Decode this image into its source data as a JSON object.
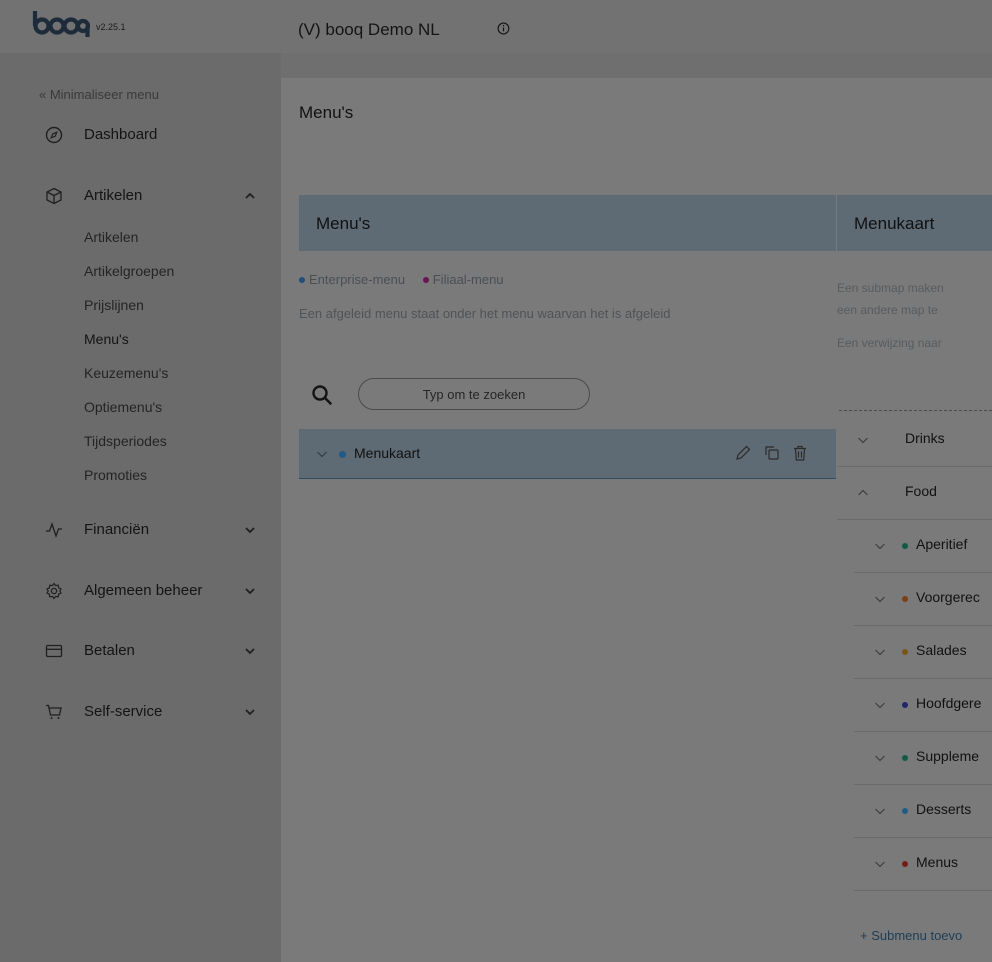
{
  "header": {
    "version": "v2.25.1",
    "venue": "(V) booq Demo NL",
    "brand_color": "#1d2b3b"
  },
  "sidebar": {
    "minimize_label": "« Minimaliseer menu",
    "dashboard": "Dashboard",
    "artikelen": {
      "label": "Artikelen",
      "items": [
        "Artikelen",
        "Artikelgroepen",
        "Prijslijnen",
        "Menu's",
        "Keuzemenu's",
        "Optiemenu's",
        "Tijdsperiodes",
        "Promoties"
      ]
    },
    "financien": "Financiën",
    "algemeen": "Algemeen beheer",
    "betalen": "Betalen",
    "selfservice": "Self-service"
  },
  "page": {
    "title": "Menu's"
  },
  "left_panel": {
    "header": "Menu's",
    "legend_enterprise": "Enterprise-menu",
    "legend_filiaal": "Filiaal-menu",
    "legend_enterprise_color": "#1f4f7a",
    "legend_filiaal_color": "#6b1550",
    "description": "Een afgeleid menu staat onder het menu waarvan het is afgeleid",
    "search_placeholder": "Typ om te zoeken",
    "menu_item": {
      "label": "Menukaart",
      "dot_color": "#1f5b86"
    }
  },
  "right_panel": {
    "header": "Menukaart",
    "info_lines": [
      "Een submap maken",
      "een andere map te",
      "Een verwijzing naar"
    ],
    "groups": [
      {
        "label": "Drinks",
        "expanded": false
      },
      {
        "label": "Food",
        "expanded": true
      }
    ],
    "food_children": [
      {
        "label": "Aperitief",
        "color": "#0f5a45"
      },
      {
        "label": "Voorgerec",
        "color": "#7a3f14"
      },
      {
        "label": "Salades",
        "color": "#7a5418"
      },
      {
        "label": "Hoofdgere",
        "color": "#23266b"
      },
      {
        "label": "Suppleme",
        "color": "#0f5a45"
      },
      {
        "label": "Desserts",
        "color": "#1f5b86"
      },
      {
        "label": "Menus",
        "color": "#7a1b1b"
      }
    ],
    "add_submenu": "+ Submenu toevo"
  }
}
